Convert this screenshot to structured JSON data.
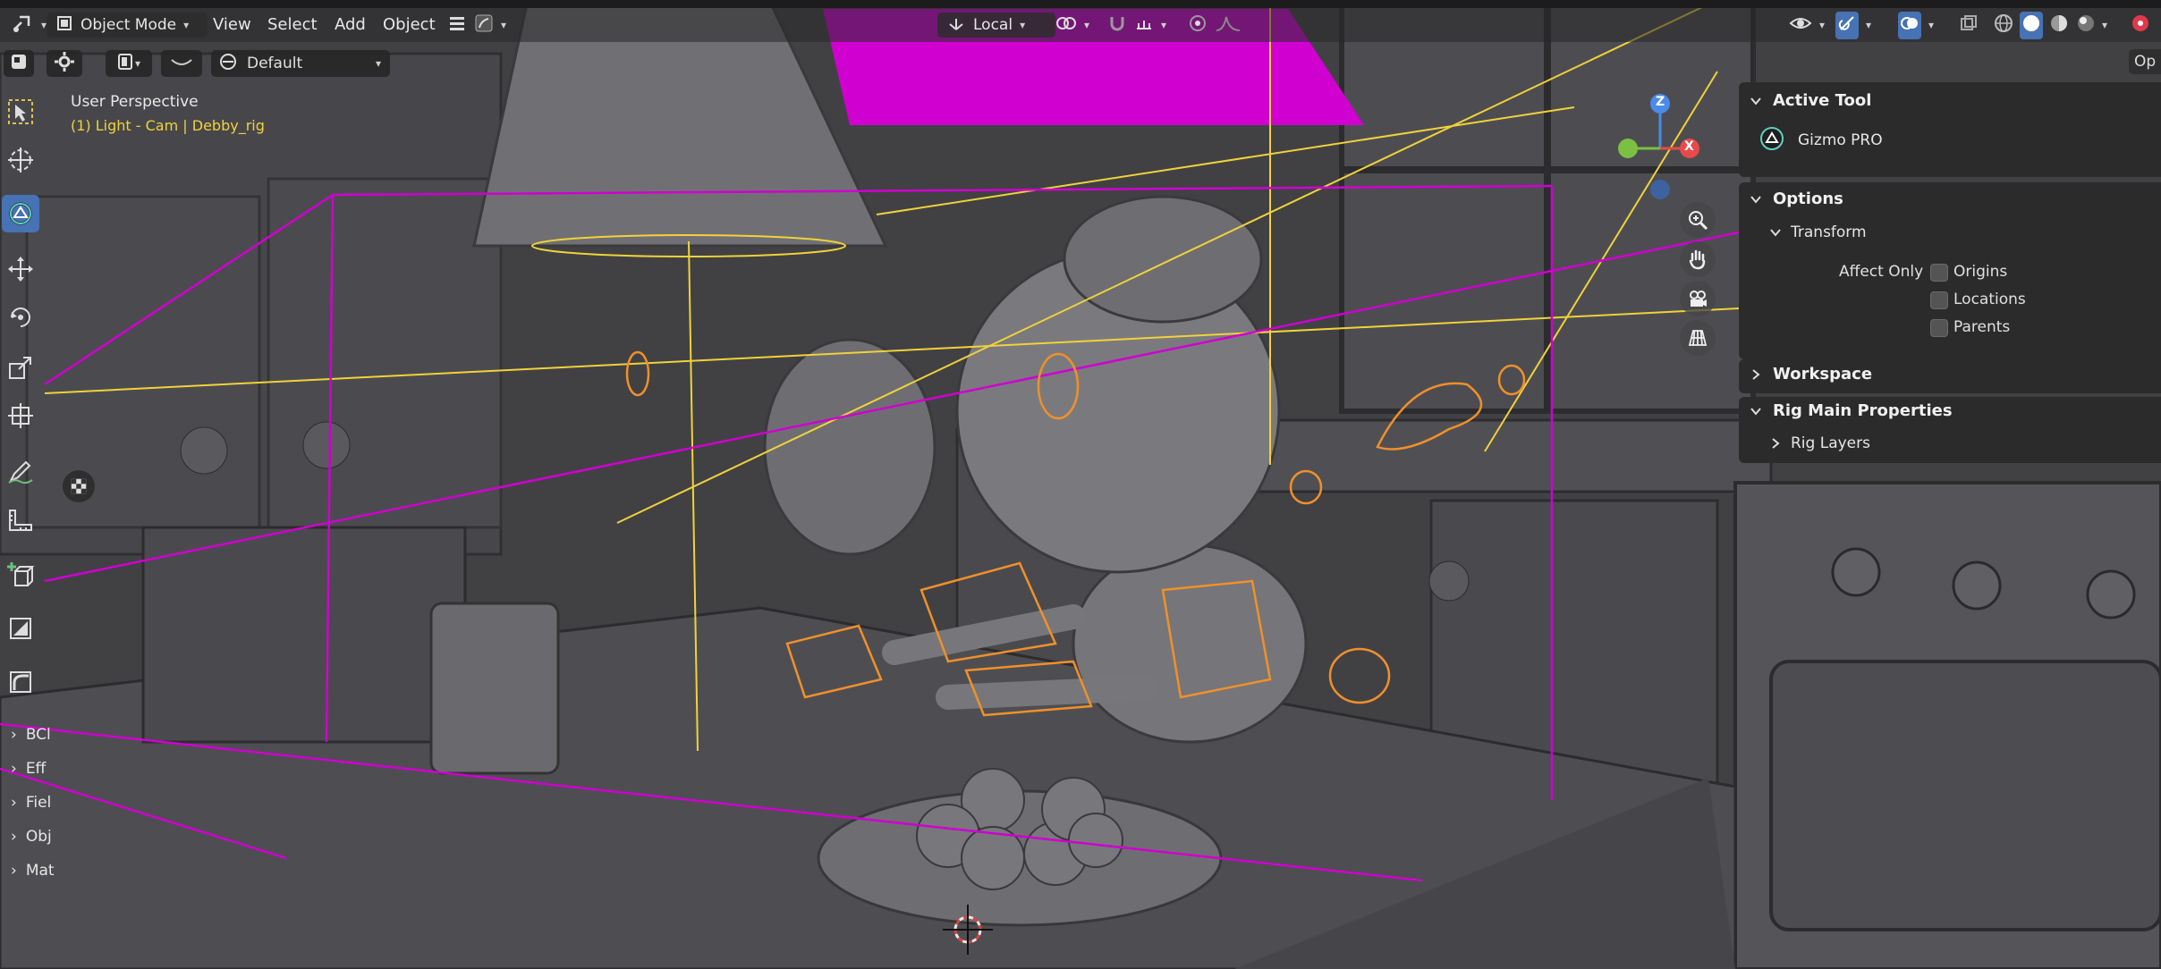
{
  "header": {
    "mode": "Object Mode",
    "menus": [
      "View",
      "Select",
      "Add",
      "Object"
    ],
    "transform_orientation": "Local"
  },
  "secondary": {
    "preset": "Default"
  },
  "viewport": {
    "perspective": "User Perspective",
    "object_info": "(1) Light - Cam | Debby_rig"
  },
  "gizmo": {
    "z_label": "Z",
    "x_label": "X"
  },
  "collapsed_panels": [
    "BCl",
    "Eff",
    "Fiel",
    "Obj",
    "Mat"
  ],
  "npanel": {
    "active_tool_title": "Active Tool",
    "active_tool_name": "Gizmo PRO",
    "options_title": "Options",
    "transform_title": "Transform",
    "affect_only_label": "Affect Only",
    "checkboxes": [
      "Origins",
      "Locations",
      "Parents"
    ],
    "workspace_title": "Workspace",
    "rig_main_title": "Rig Main Properties",
    "rig_layers_title": "Rig Layers",
    "side_tab": "Op"
  },
  "colors": {
    "accent_blue": "#4772b3",
    "light_yellow": "#f0d23a",
    "camera_magenta": "#d000d0",
    "rig_orange": "#f0902a",
    "axis_x": "#e84a4a",
    "axis_y": "#7cc043",
    "axis_z": "#4a8ae8"
  }
}
